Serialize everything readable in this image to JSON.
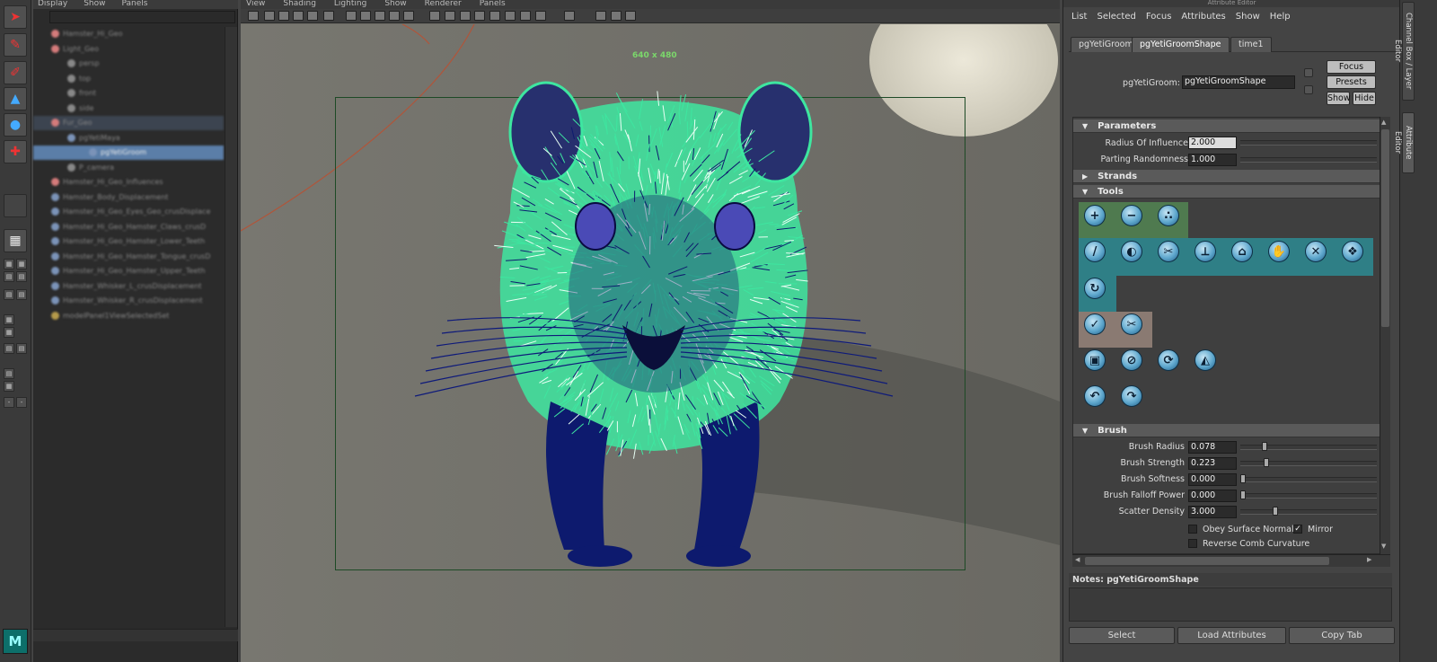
{
  "outliner": {
    "menu": [
      "Display",
      "Show",
      "Panels"
    ],
    "rows": [
      {
        "label": "Hamster_Hi_Geo",
        "type": "mesh"
      },
      {
        "label": "Light_Geo",
        "type": "mesh"
      },
      {
        "label": "persp",
        "type": "camera"
      },
      {
        "label": "top",
        "type": "camera"
      },
      {
        "label": "front",
        "type": "camera"
      },
      {
        "label": "side",
        "type": "camera"
      },
      {
        "label": "Fur_Geo",
        "type": "mesh",
        "state": "highlight"
      },
      {
        "label": "pgYetiMaya",
        "type": "node"
      },
      {
        "label": "pgYetiGroom",
        "type": "node",
        "state": "selected"
      },
      {
        "label": "P_camera",
        "type": "camera"
      },
      {
        "label": "Hamster_Hi_Geo_Influences",
        "type": "mesh"
      },
      {
        "label": "Hamster_Body_Displacement",
        "type": "shader"
      },
      {
        "label": "Hamster_Hi_Geo_Eyes_Geo_crusDisplace",
        "type": "shader"
      },
      {
        "label": "Hamster_Hi_Geo_Hamster_Claws_crusD",
        "type": "shader"
      },
      {
        "label": "Hamster_Hi_Geo_Hamster_Lower_Teeth",
        "type": "shader"
      },
      {
        "label": "Hamster_Hi_Geo_Hamster_Tongue_crusD",
        "type": "shader"
      },
      {
        "label": "Hamster_Hi_Geo_Hamster_Upper_Teeth",
        "type": "shader"
      },
      {
        "label": "Hamster_Whisker_L_crusDisplacement",
        "type": "shader"
      },
      {
        "label": "Hamster_Whisker_R_crusDisplacement",
        "type": "shader"
      },
      {
        "label": "modelPanel1ViewSelectedSet",
        "type": "set"
      }
    ]
  },
  "viewport": {
    "menu": [
      "View",
      "Shading",
      "Lighting",
      "Show",
      "Renderer",
      "Panels"
    ],
    "resolution_label": "640 x 480"
  },
  "attribute_editor": {
    "title": "Attribute Editor",
    "menu": [
      "List",
      "Selected",
      "Focus",
      "Attributes",
      "Show",
      "Help"
    ],
    "tabs": [
      {
        "label": "pgYetiGroom",
        "active": false
      },
      {
        "label": "pgYetiGroomShape",
        "active": true
      },
      {
        "label": "time1",
        "active": false
      }
    ],
    "node_label": "pgYetiGroom:",
    "node_value": "pgYetiGroomShape",
    "buttons": {
      "focus": "Focus",
      "presets": "Presets",
      "show": "Show",
      "hide": "Hide"
    },
    "parameters": {
      "header": "Parameters",
      "radius_label": "Radius Of Influence",
      "radius_value": "2.000",
      "parting_label": "Parting Randomness",
      "parting_value": "1.000"
    },
    "strands_header": "Strands",
    "tools_header": "Tools",
    "tool_icons": [
      "add-icon",
      "remove-icon",
      "scatter-icon",
      "comb-icon",
      "direction-icon",
      "cut-icon",
      "scale-icon",
      "clump-icon",
      "move-icon",
      "delete-icon",
      "twist-icon",
      "refresh-icon",
      "check-icon",
      "scissors-icon",
      "bucket-icon",
      "forbid-icon",
      "rotate-icon",
      "mirror-icon",
      "undo-icon",
      "redo-icon"
    ],
    "brush": {
      "header": "Brush",
      "rows": [
        {
          "label": "Brush Radius",
          "value": "0.078",
          "fraction": 0.2
        },
        {
          "label": "Brush Strength",
          "value": "0.223",
          "fraction": 0.22
        },
        {
          "label": "Brush Softness",
          "value": "0.000",
          "fraction": 0.0
        },
        {
          "label": "Brush Falloff Power",
          "value": "0.000",
          "fraction": 0.0
        },
        {
          "label": "Scatter Density",
          "value": "3.000",
          "fraction": 0.3
        }
      ],
      "obey_surface_normal": {
        "label": "Obey Surface Normal",
        "checked": false
      },
      "mirror": {
        "label": "Mirror",
        "checked": true
      },
      "reverse_comb": {
        "label": "Reverse Comb Curvature",
        "checked": false
      }
    },
    "notes_label": "Notes:  pgYetiGroomShape",
    "bottom_buttons": {
      "select": "Select",
      "load": "Load Attributes",
      "copy": "Copy Tab"
    }
  },
  "side_tabs": [
    "Channel Box / Layer Editor",
    "Attribute Editor"
  ],
  "colors": {
    "fur": "#3ee6a0",
    "mesh": "#0d1a6e",
    "gate": "#1d4a26",
    "selection": "#5b7ea8",
    "tool_band_green": "#4f7a4f",
    "tool_band_teal": "#2f7f86",
    "tool_band_tan": "#8a7a72"
  }
}
